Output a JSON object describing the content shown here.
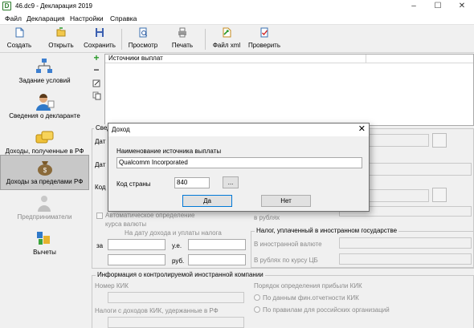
{
  "window": {
    "app_glyph": "D",
    "title": "46.dc9 - Декларация 2019",
    "minimize": "–",
    "maximize": "☐",
    "close": "✕"
  },
  "menu": [
    "Файл",
    "Декларация",
    "Настройки",
    "Справка"
  ],
  "toolbar": [
    {
      "label": "Создать",
      "icon": "new-document-icon"
    },
    {
      "label": "Открыть",
      "icon": "open-folder-icon"
    },
    {
      "label": "Сохранить",
      "icon": "floppy-disk-icon"
    },
    {
      "label": "Просмотр",
      "icon": "preview-icon"
    },
    {
      "label": "Печать",
      "icon": "printer-icon"
    },
    {
      "label": "Файл xml",
      "icon": "xml-file-icon"
    },
    {
      "label": "Проверить",
      "icon": "check-document-icon"
    }
  ],
  "nav": [
    {
      "label": "Задание условий",
      "icon": "settings-tree-icon",
      "selected": false,
      "disabled": false
    },
    {
      "label": "Сведения о декларанте",
      "icon": "user-icon",
      "selected": false,
      "disabled": false
    },
    {
      "label": "Доходы, полученные в РФ",
      "icon": "money-stack-icon",
      "selected": false,
      "disabled": false
    },
    {
      "label": "Доходы за пределами РФ",
      "icon": "money-bag-icon",
      "selected": true,
      "disabled": false
    },
    {
      "label": "Предприниматели",
      "icon": "businessman-icon",
      "selected": false,
      "disabled": true
    },
    {
      "label": "Вычеты",
      "icon": "deductions-icon",
      "selected": false,
      "disabled": false
    }
  ],
  "list_buttons": {
    "add": "+",
    "remove": "−"
  },
  "payers_list": {
    "header": "Источники выплат"
  },
  "form": {
    "group_title_partial": "Свед",
    "date1_label": "Дат",
    "date2_label": "Дат",
    "code_label": "Код",
    "auto_rate_label_line1": "Автоматическое определение",
    "auto_rate_label_line2": "курса валюты",
    "date_hint": "На дату дохода и уплаты налога",
    "za_label": "за",
    "ue_label": "у.е.",
    "rub_label": "руб.",
    "in_rubles_label": "в рублях",
    "tax_group_title": "Налог, уплаченный в иностранном государстве",
    "tax_in_currency": "В иностранной валюте",
    "tax_in_rubles": "В рублях по курсу ЦБ"
  },
  "kik": {
    "group_title": "Информация о контролируемой иностранной компании",
    "number_label": "Номер КИК",
    "taxes_label": "Налоги с доходов КИК, удержанные в РФ",
    "profit_order_label": "Порядок определения прибыли КИК",
    "radio1": "По данным фин.отчетности КИК",
    "radio2": "По правилам для российских организаций"
  },
  "dialog": {
    "title": "Доход",
    "close": "✕",
    "source_label": "Наименование источника выплаты",
    "source_value": "Qualcomm Incorporated",
    "country_label": "Код страны",
    "country_value": "840",
    "browse_label": "...",
    "yes_label": "Да",
    "no_label": "Нет"
  }
}
